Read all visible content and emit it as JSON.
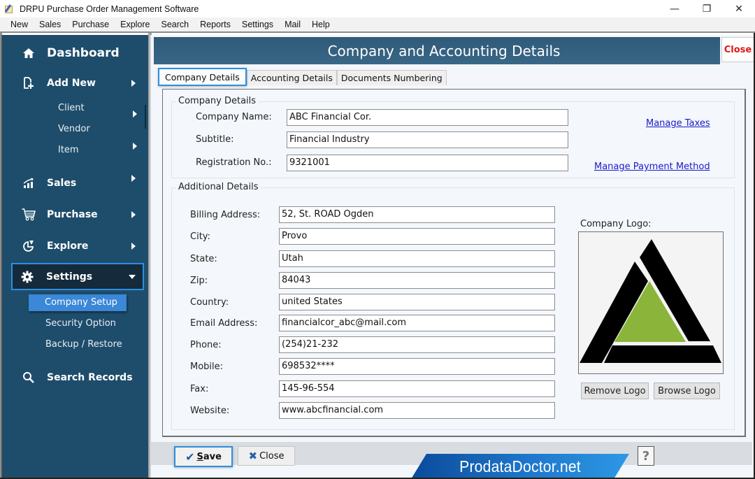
{
  "window": {
    "title": "DRPU Purchase Order Management Software",
    "controls": {
      "minimize": "—",
      "maximize": "❐",
      "close": "✕"
    }
  },
  "menubar": [
    "New",
    "Sales",
    "Purchase",
    "Explore",
    "Search",
    "Reports",
    "Settings",
    "Mail",
    "Help"
  ],
  "sidebar": {
    "dashboard": {
      "label": "Dashboard",
      "icon": "home-icon"
    },
    "add_new": {
      "label": "Add New",
      "icon": "add-document-icon",
      "children": [
        "Client",
        "Vendor",
        "Item"
      ]
    },
    "sales": {
      "label": "Sales",
      "icon": "chart-up-icon"
    },
    "purchase": {
      "label": "Purchase",
      "icon": "cart-icon"
    },
    "explore": {
      "label": "Explore",
      "icon": "pie-chart-icon"
    },
    "settings": {
      "label": "Settings",
      "icon": "gear-icon",
      "expanded": true,
      "children": [
        "Company Setup",
        "Security Option",
        "Backup / Restore"
      ],
      "selected": "Company Setup"
    },
    "search_records": {
      "label": "Search Records",
      "icon": "search-icon"
    }
  },
  "header": {
    "title": "Company and Accounting Details",
    "close_label": "Close"
  },
  "tabs": [
    {
      "label": "Company Details",
      "active": true
    },
    {
      "label": "Accounting Details",
      "active": false
    },
    {
      "label": "Documents Numbering",
      "active": false
    }
  ],
  "company_details": {
    "group_title": "Company Details",
    "fields": [
      {
        "label": "Company Name:",
        "value": "ABC Financial Cor."
      },
      {
        "label": "Subtitle:",
        "value": "Financial Industry"
      },
      {
        "label": "Registration No.:",
        "value": "9321001"
      }
    ],
    "links": {
      "manage_taxes": "Manage Taxes",
      "manage_payment": "Manage Payment Method"
    }
  },
  "additional_details": {
    "group_title": "Additional Details",
    "fields": [
      {
        "label": "Billing Address:",
        "value": "52, St. ROAD Ogden"
      },
      {
        "label": "City:",
        "value": "Provo"
      },
      {
        "label": "State:",
        "value": "Utah"
      },
      {
        "label": "Zip:",
        "value": "84043"
      },
      {
        "label": "Country:",
        "value": "united States"
      },
      {
        "label": "Email Address:",
        "value": "financialcor_abc@mail.com"
      },
      {
        "label": "Phone:",
        "value": "(254)21-232"
      },
      {
        "label": "Mobile:",
        "value": "698532****"
      },
      {
        "label": "Fax:",
        "value": "145-96-554"
      },
      {
        "label": "Website:",
        "value": "www.abcfinancial.com"
      }
    ],
    "logo": {
      "label": "Company Logo:",
      "colors": {
        "outer": "#000000",
        "inner": "#8ab53a"
      },
      "remove_label": "Remove Logo",
      "browse_label": "Browse Logo"
    }
  },
  "footer": {
    "save_label": "Save",
    "save_mnemonic": "S",
    "save_rest": "ave",
    "close_label": "Close",
    "brand": "ProdataDoctor.net",
    "help_label": "?"
  },
  "colors": {
    "sidebar_bg": "#1e4d6b",
    "header_bg": "#2f5a78",
    "accent_blue": "#2d8fe0",
    "selected_item": "#3b87d8",
    "close_red": "#e11818",
    "link_blue": "#1a1acc"
  }
}
